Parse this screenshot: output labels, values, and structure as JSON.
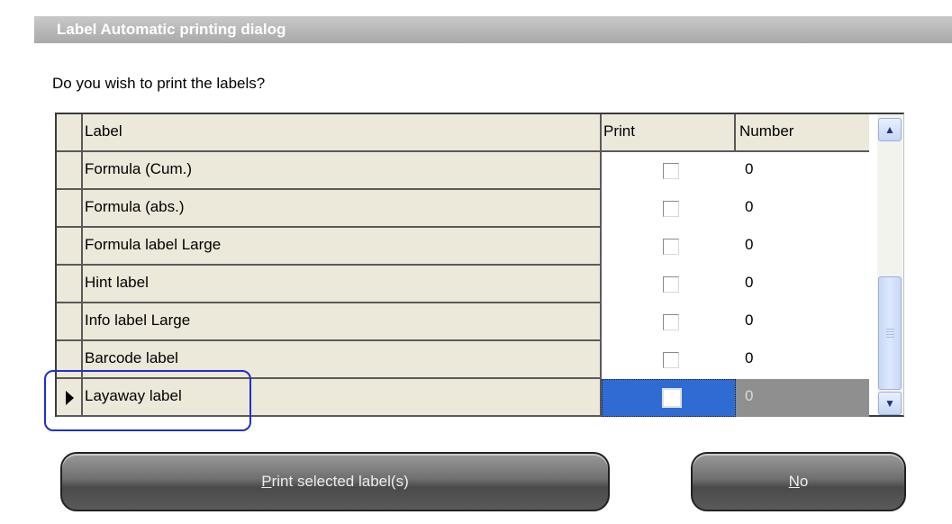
{
  "window": {
    "title": "Label Automatic printing dialog"
  },
  "question": "Do you wish to print the labels?",
  "columns": {
    "label": "Label",
    "print": "Print",
    "number": "Number"
  },
  "rows": [
    {
      "label": "Formula (Cum.)",
      "print": false,
      "number": "0"
    },
    {
      "label": "Formula (abs.)",
      "print": false,
      "number": "0"
    },
    {
      "label": "Formula label Large",
      "print": false,
      "number": "0"
    },
    {
      "label": "Hint label",
      "print": false,
      "number": "0"
    },
    {
      "label": "Info label Large",
      "print": false,
      "number": "0"
    },
    {
      "label": "Barcode label",
      "print": false,
      "number": "0"
    },
    {
      "label": "Layaway label",
      "print": false,
      "number": "0",
      "current": true
    }
  ],
  "icons": {
    "current_row": "row-pointer-icon",
    "scroll_up": "chevron-up-icon",
    "scroll_down": "chevron-down-icon"
  },
  "buttons": {
    "print": {
      "mnemonic": "P",
      "rest": "rint selected label(s)"
    },
    "no": {
      "mnemonic": "N",
      "rest": "o"
    }
  },
  "colors": {
    "selection": "#2f6bd2",
    "focus_outline": "#1f2fcf",
    "grid_header": "#ece8da"
  }
}
